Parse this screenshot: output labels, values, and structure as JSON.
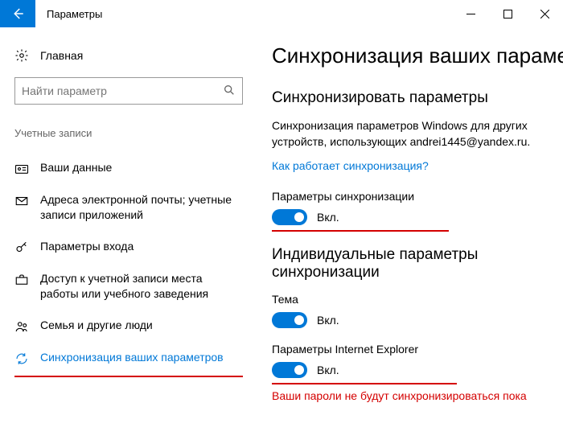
{
  "titlebar": {
    "title": "Параметры"
  },
  "sidebar": {
    "home": "Главная",
    "search_placeholder": "Найти параметр",
    "section": "Учетные записи",
    "items": [
      {
        "label": "Ваши данные"
      },
      {
        "label": "Адреса электронной почты; учетные записи приложений"
      },
      {
        "label": "Параметры входа"
      },
      {
        "label": "Доступ к учетной записи места работы или учебного заведения"
      },
      {
        "label": "Семья и другие люди"
      },
      {
        "label": "Синхронизация ваших параметров"
      }
    ]
  },
  "content": {
    "heading": "Синхронизация ваших параме",
    "section1_title": "Синхронизировать параметры",
    "section1_desc": "Синхронизация параметров Windows для других устройств, использующих andrei1445@yandex.ru.",
    "link": "Как работает синхронизация?",
    "sync_label": "Параметры синхронизации",
    "on_text": "Вкл.",
    "section2_title": "Индивидуальные параметры синхронизации",
    "theme_label": "Тема",
    "ie_label": "Параметры Internet Explorer",
    "warning": "Ваши пароли не будут синхронизироваться пока"
  }
}
